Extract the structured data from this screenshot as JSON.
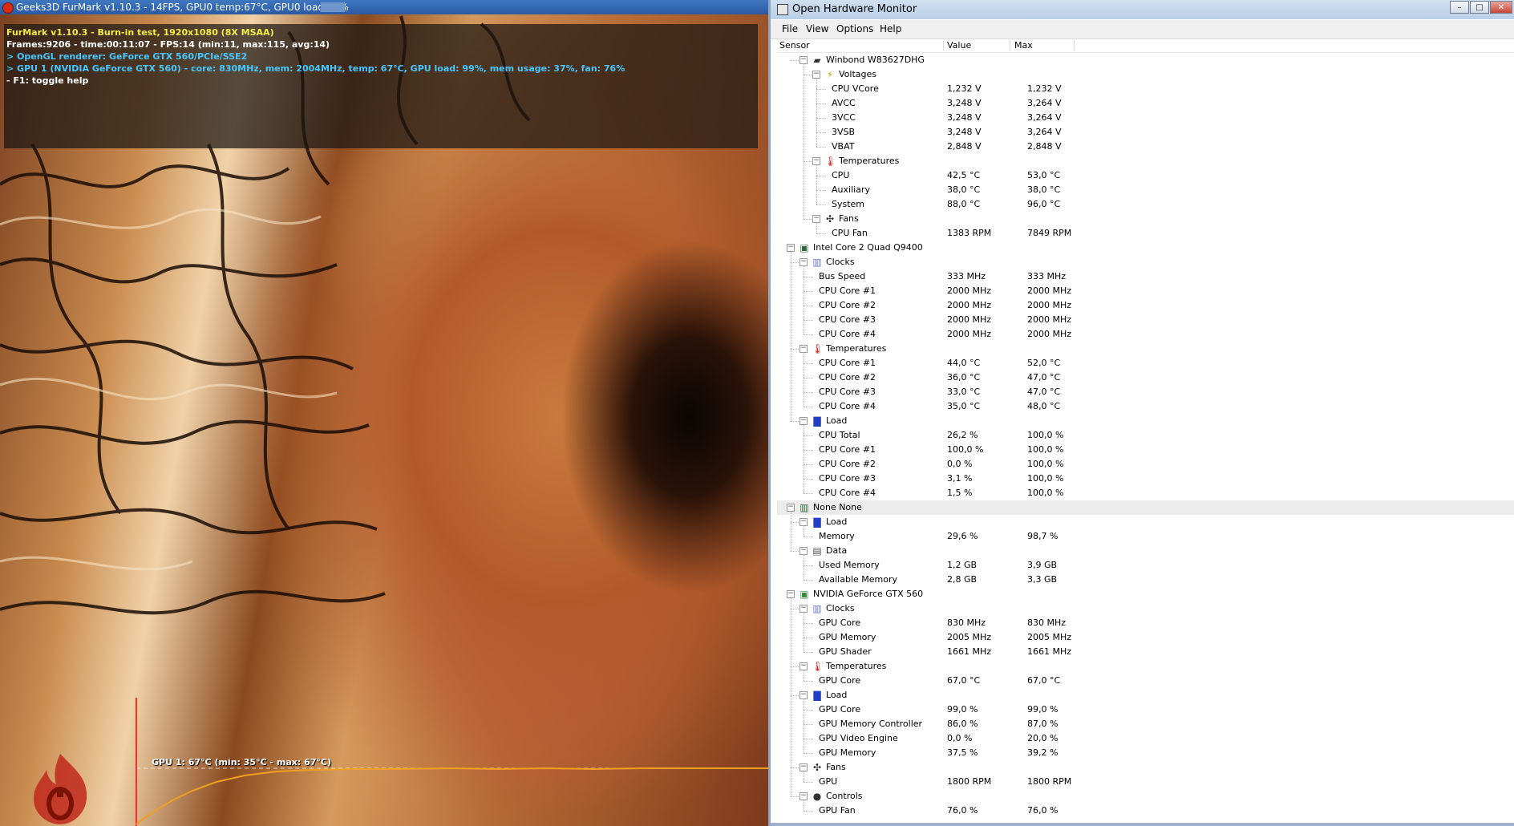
{
  "furmark": {
    "title": "Geeks3D FurMark v1.10.3 - 14FPS, GPU0 temp:67°C, GPU0 load:99%",
    "overlay": [
      {
        "text": "FurMark v1.10.3 - Burn-in test, 1920x1080 (8X MSAA)",
        "color": "yellow"
      },
      {
        "text": "Frames:9206 - time:00:11:07 - FPS:14 (min:11, max:115, avg:14)",
        "color": "white"
      },
      {
        "text": "> OpenGL renderer: GeForce GTX 560/PCIe/SSE2",
        "color": "cyan"
      },
      {
        "text": "> GPU 1 (NVIDIA GeForce GTX 560) - core: 830MHz, mem: 2004MHz, temp: 67°C, GPU load: 99%, mem usage: 37%, fan: 76%",
        "color": "cyan"
      },
      {
        "text": "- F1: toggle help",
        "color": "white"
      }
    ],
    "graph_label": "GPU 1: 67°C (min: 35°C - max: 67°C)",
    "graph": {
      "min": 35,
      "max": 67,
      "current": 67
    }
  },
  "ohm": {
    "title": "Open Hardware Monitor",
    "menu": [
      "File",
      "View",
      "Options",
      "Help"
    ],
    "columns": [
      "Sensor",
      "Value",
      "Max"
    ],
    "rows": [
      {
        "d": 1,
        "kind": "hw",
        "icon": "chip-icon",
        "label": "Winbond W83627DHG",
        "toggle": true
      },
      {
        "d": 2,
        "kind": "group",
        "icon": "voltage-icon",
        "label": "Voltages",
        "toggle": true
      },
      {
        "d": 3,
        "label": "CPU VCore",
        "value": "1,232 V",
        "max": "1,232 V"
      },
      {
        "d": 3,
        "label": "AVCC",
        "value": "3,248 V",
        "max": "3,264 V"
      },
      {
        "d": 3,
        "label": "3VCC",
        "value": "3,248 V",
        "max": "3,264 V"
      },
      {
        "d": 3,
        "label": "3VSB",
        "value": "3,248 V",
        "max": "3,264 V"
      },
      {
        "d": 3,
        "label": "VBAT",
        "value": "2,848 V",
        "max": "2,848 V"
      },
      {
        "d": 2,
        "kind": "group",
        "icon": "thermometer-icon",
        "label": "Temperatures",
        "toggle": true
      },
      {
        "d": 3,
        "label": "CPU",
        "value": "42,5 °C",
        "max": "53,0 °C"
      },
      {
        "d": 3,
        "label": "Auxiliary",
        "value": "38,0 °C",
        "max": "38,0 °C"
      },
      {
        "d": 3,
        "label": "System",
        "value": "88,0 °C",
        "max": "96,0 °C"
      },
      {
        "d": 2,
        "kind": "group",
        "icon": "fan-icon",
        "label": "Fans",
        "toggle": true
      },
      {
        "d": 3,
        "label": "CPU Fan",
        "value": "1383 RPM",
        "max": "7849 RPM"
      },
      {
        "d": 0,
        "kind": "hw",
        "icon": "cpu-icon",
        "label": "Intel Core 2 Quad Q9400",
        "toggle": true
      },
      {
        "d": 1,
        "kind": "group",
        "icon": "clock-icon",
        "label": "Clocks",
        "toggle": true
      },
      {
        "d": 2,
        "label": "Bus Speed",
        "value": "333 MHz",
        "max": "333 MHz"
      },
      {
        "d": 2,
        "label": "CPU Core #1",
        "value": "2000 MHz",
        "max": "2000 MHz"
      },
      {
        "d": 2,
        "label": "CPU Core #2",
        "value": "2000 MHz",
        "max": "2000 MHz"
      },
      {
        "d": 2,
        "label": "CPU Core #3",
        "value": "2000 MHz",
        "max": "2000 MHz"
      },
      {
        "d": 2,
        "label": "CPU Core #4",
        "value": "2000 MHz",
        "max": "2000 MHz"
      },
      {
        "d": 1,
        "kind": "group",
        "icon": "thermometer-icon",
        "label": "Temperatures",
        "toggle": true
      },
      {
        "d": 2,
        "label": "CPU Core #1",
        "value": "44,0 °C",
        "max": "52,0 °C"
      },
      {
        "d": 2,
        "label": "CPU Core #2",
        "value": "36,0 °C",
        "max": "47,0 °C"
      },
      {
        "d": 2,
        "label": "CPU Core #3",
        "value": "33,0 °C",
        "max": "47,0 °C"
      },
      {
        "d": 2,
        "label": "CPU Core #4",
        "value": "35,0 °C",
        "max": "48,0 °C"
      },
      {
        "d": 1,
        "kind": "group",
        "icon": "load-icon",
        "label": "Load",
        "toggle": true
      },
      {
        "d": 2,
        "label": "CPU Total",
        "value": "26,2 %",
        "max": "100,0 %"
      },
      {
        "d": 2,
        "label": "CPU Core #1",
        "value": "100,0 %",
        "max": "100,0 %"
      },
      {
        "d": 2,
        "label": "CPU Core #2",
        "value": "0,0 %",
        "max": "100,0 %"
      },
      {
        "d": 2,
        "label": "CPU Core #3",
        "value": "3,1 %",
        "max": "100,0 %"
      },
      {
        "d": 2,
        "label": "CPU Core #4",
        "value": "1,5 %",
        "max": "100,0 %"
      },
      {
        "d": 0,
        "kind": "hw",
        "icon": "ram-icon",
        "label": "None None",
        "toggle": true,
        "highlight": true
      },
      {
        "d": 1,
        "kind": "group",
        "icon": "load-icon",
        "label": "Load",
        "toggle": true
      },
      {
        "d": 2,
        "label": "Memory",
        "value": "29,6 %",
        "max": "98,7 %"
      },
      {
        "d": 1,
        "kind": "group",
        "icon": "data-icon",
        "label": "Data",
        "toggle": true
      },
      {
        "d": 2,
        "label": "Used Memory",
        "value": "1,2 GB",
        "max": "3,9 GB"
      },
      {
        "d": 2,
        "label": "Available Memory",
        "value": "2,8 GB",
        "max": "3,3 GB"
      },
      {
        "d": 0,
        "kind": "hw",
        "icon": "gpu-icon",
        "label": "NVIDIA GeForce GTX 560",
        "toggle": true
      },
      {
        "d": 1,
        "kind": "group",
        "icon": "clock-icon",
        "label": "Clocks",
        "toggle": true
      },
      {
        "d": 2,
        "label": "GPU Core",
        "value": "830 MHz",
        "max": "830 MHz"
      },
      {
        "d": 2,
        "label": "GPU Memory",
        "value": "2005 MHz",
        "max": "2005 MHz"
      },
      {
        "d": 2,
        "label": "GPU Shader",
        "value": "1661 MHz",
        "max": "1661 MHz"
      },
      {
        "d": 1,
        "kind": "group",
        "icon": "thermometer-icon",
        "label": "Temperatures",
        "toggle": true
      },
      {
        "d": 2,
        "label": "GPU Core",
        "value": "67,0 °C",
        "max": "67,0 °C"
      },
      {
        "d": 1,
        "kind": "group",
        "icon": "load-icon",
        "label": "Load",
        "toggle": true
      },
      {
        "d": 2,
        "label": "GPU Core",
        "value": "99,0 %",
        "max": "99,0 %"
      },
      {
        "d": 2,
        "label": "GPU Memory Controller",
        "value": "86,0 %",
        "max": "87,0 %"
      },
      {
        "d": 2,
        "label": "GPU Video Engine",
        "value": "0,0 %",
        "max": "20,0 %"
      },
      {
        "d": 2,
        "label": "GPU Memory",
        "value": "37,5 %",
        "max": "39,2 %"
      },
      {
        "d": 1,
        "kind": "group",
        "icon": "fan-icon",
        "label": "Fans",
        "toggle": true
      },
      {
        "d": 2,
        "label": "GPU",
        "value": "1800 RPM",
        "max": "1800 RPM"
      },
      {
        "d": 1,
        "kind": "group",
        "icon": "control-icon",
        "label": "Controls",
        "toggle": true
      },
      {
        "d": 2,
        "label": "GPU Fan",
        "value": "76,0 %",
        "max": "76,0 %"
      }
    ]
  },
  "colors": {
    "yellow": "#f4ee47",
    "white": "#ffffff",
    "cyan": "#46c7ff",
    "graph_line": "#f0a020",
    "graph_marker": "#ff2a2a"
  }
}
